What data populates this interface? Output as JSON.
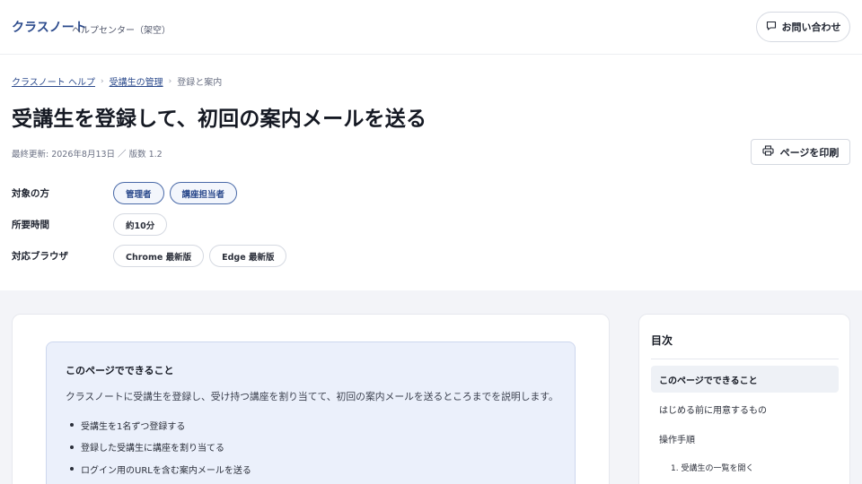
{
  "header": {
    "brand": "クラスノート",
    "brand_sub": "ヘルプセンター（架空）",
    "contact_label": "お問い合わせ"
  },
  "breadcrumb": {
    "items": [
      "クラスノート ヘルプ",
      "受講生の管理",
      "登録と案内"
    ],
    "separator": "›"
  },
  "article": {
    "title": "受講生を登録して、初回の案内メールを送る",
    "meta": "最終更新: 2026年8月13日 ／ 版数 1.2",
    "print_label": "ページを印刷",
    "attributes": [
      {
        "label": "対象の方",
        "values": [
          "管理者",
          "講座担当者"
        ]
      },
      {
        "label": "所要時間",
        "values": [
          "約10分"
        ]
      },
      {
        "label": "対応ブラウザ",
        "values": [
          "Chrome 最新版",
          "Edge 最新版"
        ]
      }
    ]
  },
  "summary": {
    "title": "このページでできること",
    "description": "クラスノートに受講生を登録し、受け持つ講座を割り当てて、初回の案内メールを送るところまでを説明します。",
    "items": [
      "受講生を1名ずつ登録する",
      "登録した受講生に講座を割り当てる",
      "ログイン用のURLを含む案内メールを送る"
    ]
  },
  "toc": {
    "heading": "目次",
    "items": [
      "このページでできること",
      "はじめる前に用意するもの",
      "操作手順"
    ],
    "active_index": 0,
    "subitems": [
      "1. 受講生の一覧を開く"
    ]
  },
  "colors": {
    "accent": "#2b4a8c",
    "info_bg": "#ebf0fb",
    "page_bg": "#f3f4f8"
  }
}
